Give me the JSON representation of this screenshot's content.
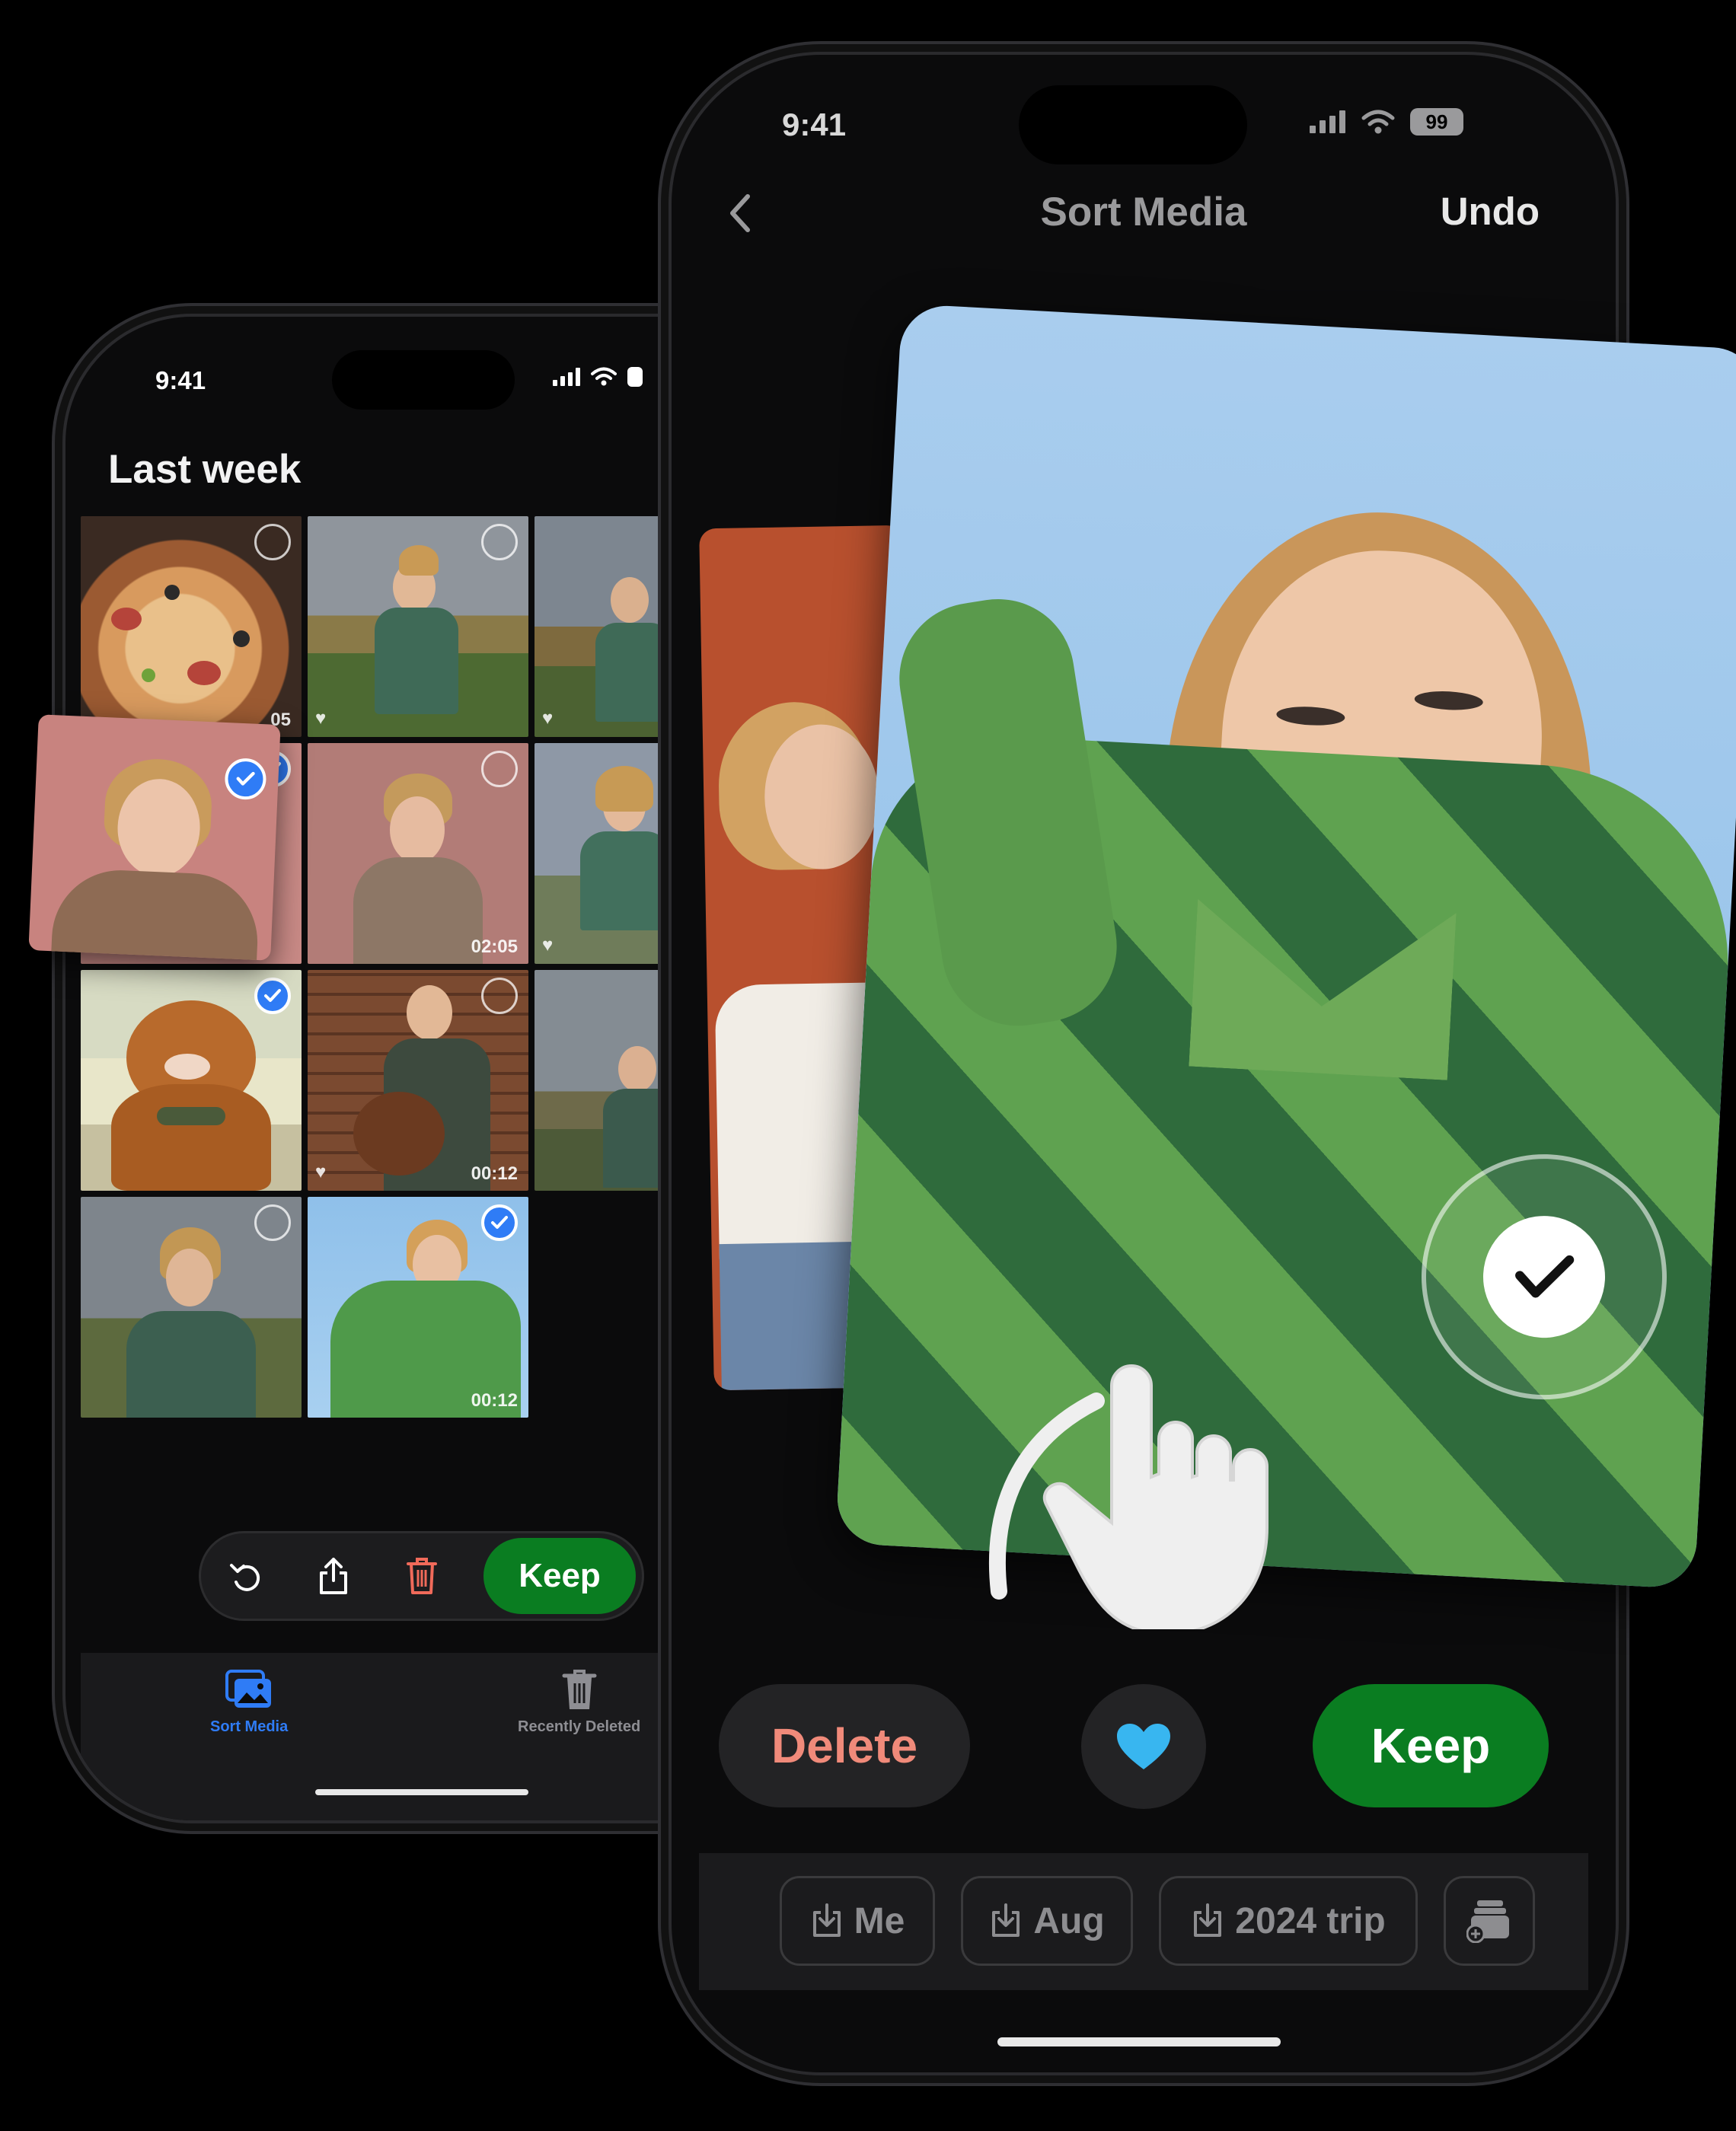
{
  "back_phone": {
    "status_time": "9:41",
    "grid_title": "Last week",
    "tiles": [
      {
        "label": "pizza-photo",
        "selected": false,
        "heart": false,
        "duration": "05"
      },
      {
        "label": "woman-waving-photo",
        "selected": false,
        "heart": true,
        "duration": ""
      },
      {
        "label": "woman-field-photo",
        "selected": false,
        "heart": true,
        "duration": ""
      },
      {
        "label": "woman-pink-photo",
        "selected": true,
        "heart": false,
        "duration": ""
      },
      {
        "label": "woman-coat-photo",
        "selected": false,
        "heart": false,
        "duration": "02:05"
      },
      {
        "label": "woman-sky-photo",
        "selected": false,
        "heart": true,
        "duration": ""
      },
      {
        "label": "poodle-photo",
        "selected": true,
        "heart": false,
        "duration": ""
      },
      {
        "label": "woman-dog-brick-photo",
        "selected": false,
        "heart": true,
        "duration": "00:12"
      },
      {
        "label": "woman-road-photo",
        "selected": false,
        "heart": false,
        "duration": ""
      },
      {
        "label": "woman-garden-photo",
        "selected": false,
        "heart": false,
        "duration": ""
      },
      {
        "label": "woman-green-sweater-photo",
        "selected": true,
        "heart": false,
        "duration": "00:12"
      }
    ],
    "keep_label": "Keep",
    "tabs": [
      {
        "label": "Sort Media",
        "active": true
      },
      {
        "label": "Recently Deleted",
        "active": false
      }
    ]
  },
  "front_phone": {
    "status_time": "9:41",
    "battery": "99",
    "title": "Sort Media",
    "undo_label": "Undo",
    "delete_label": "Delete",
    "keep_label": "Keep",
    "albums": [
      {
        "label": "Me"
      },
      {
        "label": "Aug"
      },
      {
        "label": "2024 trip"
      }
    ]
  },
  "colors": {
    "keep_green": "#0a7d21",
    "delete_salmon": "#f08a7a",
    "accent_blue": "#2f7cf6",
    "heart_blue": "#38b6f0"
  }
}
